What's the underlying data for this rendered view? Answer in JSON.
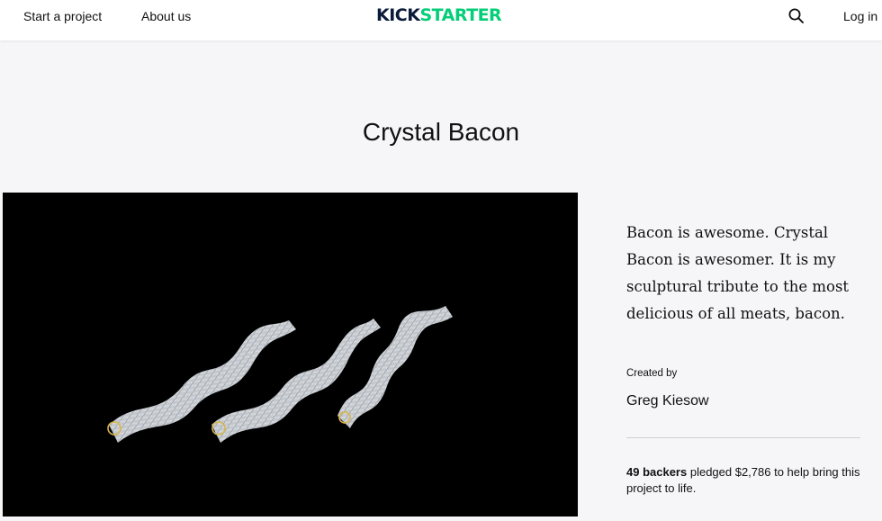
{
  "nav": {
    "start_project": "Start a project",
    "about_us": "About us",
    "logo_part1": "KICK",
    "logo_part2": "STARTER",
    "log_in": "Log in",
    "search_icon": "search-icon"
  },
  "colors": {
    "brand_green": "#05ce78",
    "brand_navy": "#0b1b3a",
    "page_bg": "#f6f6f8"
  },
  "project": {
    "title": "Crystal Bacon",
    "blurb": "Bacon is awesome. Crystal Bacon is awesomer. It is my sculptural tribute to the most delicious of all meats, bacon.",
    "created_by_label": "Created by",
    "creator": "Greg Kiesow",
    "backers_count": "49 backers",
    "backers_rest": " pledged $2,786 to help bring this project to life."
  }
}
